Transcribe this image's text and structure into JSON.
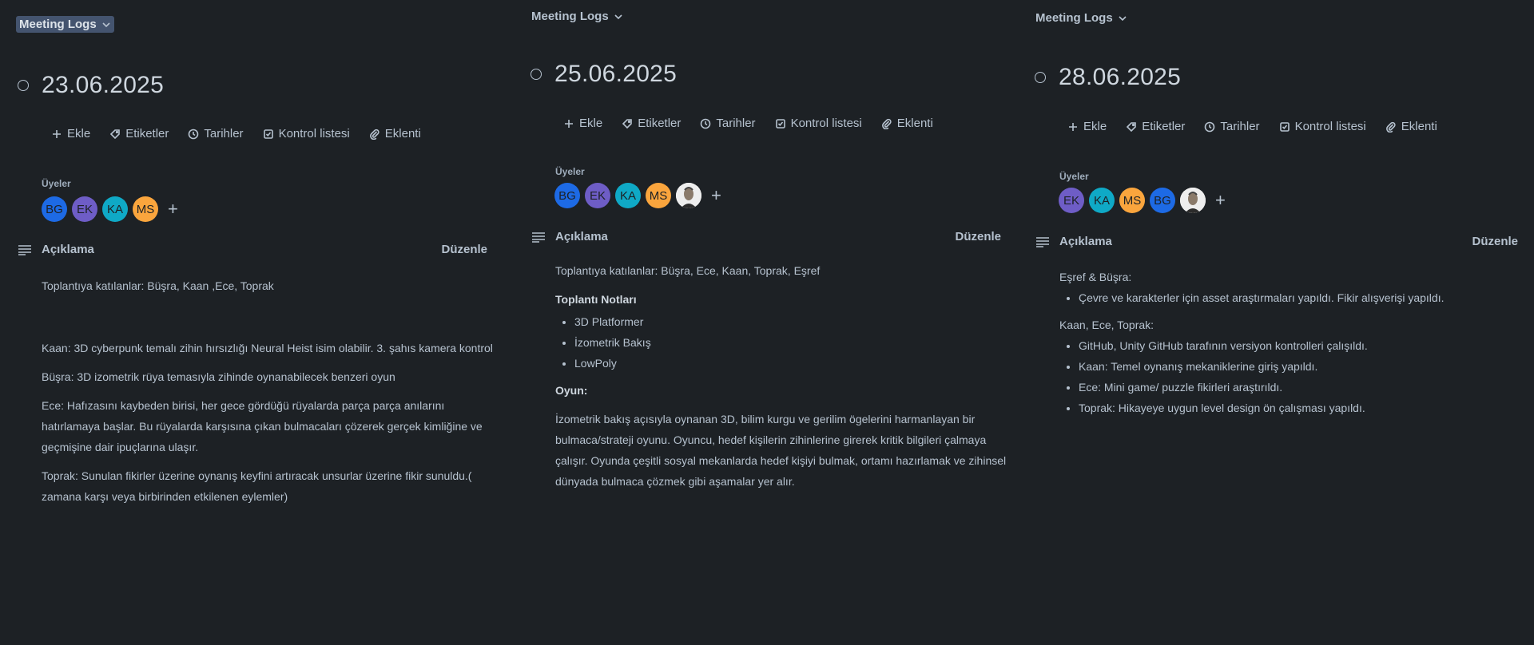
{
  "panels": [
    {
      "list_name": "Meeting Logs",
      "card_title": "23.06.2025",
      "actions": {
        "add": "Ekle",
        "labels": "Etiketler",
        "dates": "Tarihler",
        "checklist": "Kontrol listesi",
        "attachment": "Eklenti"
      },
      "members_label": "Üyeler",
      "members": [
        {
          "initials": "BG",
          "color": "#1d6ae5"
        },
        {
          "initials": "EK",
          "color": "#6e5dc6"
        },
        {
          "initials": "KA",
          "color": "#0fa9c6"
        },
        {
          "initials": "MS",
          "color": "#faa53d"
        }
      ],
      "description_label": "Açıklama",
      "edit_label": "Düzenle",
      "description": {
        "intro": "Toplantıya katılanlar: Büşra, Kaan ,Ece, Toprak",
        "paragraphs": [
          "Kaan: 3D cyberpunk temalı zihin hırsızlığı Neural Heist isim olabilir. 3. şahıs kamera kontrol",
          "Büşra: 3D izometrik rüya temasıyla zihinde oynanabilecek benzeri oyun",
          "Ece: Hafızasını kaybeden birisi, her gece gördüğü rüyalarda parça parça anılarını hatırlamaya başlar. Bu rüyalarda karşısına çıkan bulmacaları çözerek gerçek kimliğine ve geçmişine dair ipuçlarına ulaşır.",
          "Toprak: Sunulan fikirler üzerine oynanış keyfini artıracak unsurlar üzerine fikir sunuldu.( zamana karşı veya birbirinden etkilenen eylemler)"
        ]
      }
    },
    {
      "list_name": "Meeting Logs",
      "card_title": "25.06.2025",
      "actions": {
        "add": "Ekle",
        "labels": "Etiketler",
        "dates": "Tarihler",
        "checklist": "Kontrol listesi",
        "attachment": "Eklenti"
      },
      "members_label": "Üyeler",
      "members": [
        {
          "initials": "BG",
          "color": "#1d6ae5"
        },
        {
          "initials": "EK",
          "color": "#6e5dc6"
        },
        {
          "initials": "KA",
          "color": "#0fa9c6"
        },
        {
          "initials": "MS",
          "color": "#faa53d"
        }
      ],
      "description_label": "Açıklama",
      "edit_label": "Düzenle",
      "description": {
        "intro": "Toplantıya katılanlar: Büşra, Ece, Kaan, Toprak, Eşref",
        "notes_heading": "Toplantı Notları",
        "notes": [
          "3D Platformer",
          "İzometrik Bakış",
          "LowPoly"
        ],
        "game_heading": "Oyun:",
        "game_text": "İzometrik bakış açısıyla oynanan 3D, bilim kurgu ve gerilim ögelerini harmanlayan bir bulmaca/strateji oyunu. Oyuncu, hedef kişilerin zihinlerine girerek kritik bilgileri çalmaya çalışır. Oyunda çeşitli sosyal mekanlarda hedef kişiyi bulmak, ortamı hazırlamak ve zihinsel dünyada bulmaca çözmek gibi aşamalar yer alır."
      }
    },
    {
      "list_name": "Meeting Logs",
      "card_title": "28.06.2025",
      "actions": {
        "add": "Ekle",
        "labels": "Etiketler",
        "dates": "Tarihler",
        "checklist": "Kontrol listesi",
        "attachment": "Eklenti"
      },
      "members_label": "Üyeler",
      "members": [
        {
          "initials": "EK",
          "color": "#6e5dc6"
        },
        {
          "initials": "KA",
          "color": "#0fa9c6"
        },
        {
          "initials": "MS",
          "color": "#faa53d"
        },
        {
          "initials": "BG",
          "color": "#1d6ae5"
        }
      ],
      "description_label": "Açıklama",
      "edit_label": "Düzenle",
      "description": {
        "group1_heading": "Eşref & Büşra:",
        "group1_items": [
          "Çevre ve karakterler için asset araştırmaları yapıldı. Fikir alışverişi yapıldı."
        ],
        "group2_heading": "Kaan, Ece, Toprak:",
        "group2_items": [
          "GitHub, Unity GitHub tarafının versiyon kontrolleri çalışıldı.",
          "Kaan: Temel oynanış mekaniklerine giriş yapıldı.",
          "Ece: Mini game/ puzzle fikirleri araştırıldı.",
          "Toprak: Hikayeye uygun level design ön çalışması yapıldı."
        ]
      }
    }
  ]
}
